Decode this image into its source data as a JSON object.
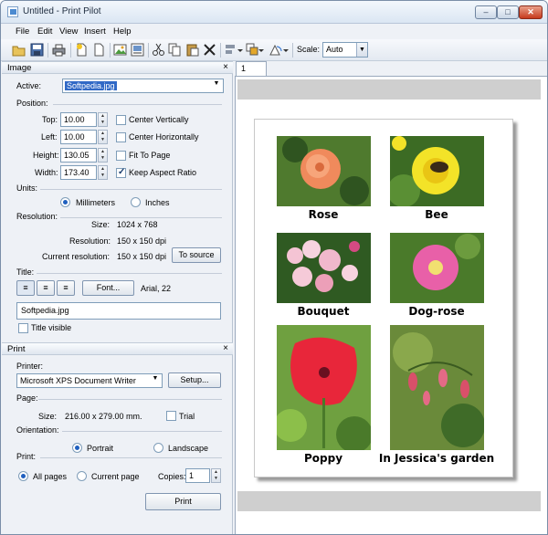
{
  "window": {
    "title": "Untitled - Print Pilot"
  },
  "menu": [
    "File",
    "Edit",
    "View",
    "Insert",
    "Help"
  ],
  "toolbar": {
    "scale_label": "Scale:",
    "scale_value": "Auto"
  },
  "image_panel": {
    "title": "Image",
    "active_label": "Active:",
    "active_value": "Softpedia.jpg",
    "position_label": "Position:",
    "top_label": "Top:",
    "top_value": "10.00",
    "left_label": "Left:",
    "left_value": "10.00",
    "height_label": "Height:",
    "height_value": "130.05",
    "width_label": "Width:",
    "width_value": "173.40",
    "center_vertically": "Center Vertically",
    "center_horizontally": "Center Horizontally",
    "fit_to_page": "Fit To Page",
    "keep_aspect": "Keep Aspect Ratio",
    "units_label": "Units:",
    "millimeters": "Millimeters",
    "inches": "Inches",
    "resolution_label": "Resolution:",
    "size_label": "Size:",
    "size_value": "1024 x 768",
    "resolution_row_label": "Resolution:",
    "resolution_value": "150 x 150 dpi",
    "current_resolution_label": "Current resolution:",
    "current_resolution_value": "150 x 150 dpi",
    "to_source": "To source",
    "title_label": "Title:",
    "font_button": "Font...",
    "font_value": "Arial, 22",
    "title_text": "Softpedia.jpg",
    "title_visible": "Title visible"
  },
  "print_panel": {
    "title": "Print",
    "printer_label": "Printer:",
    "printer_value": "Microsoft XPS Document Writer",
    "setup": "Setup...",
    "page_label": "Page:",
    "page_size_label": "Size:",
    "page_size_value": "216.00 x 279.00 mm.",
    "trial": "Trial",
    "orientation_label": "Orientation:",
    "portrait": "Portrait",
    "landscape": "Landscape",
    "print_label": "Print:",
    "all_pages": "All pages",
    "current_page": "Current page",
    "copies_label": "Copies:",
    "copies_value": "1",
    "print_button": "Print"
  },
  "tabs": [
    "1"
  ],
  "photos": [
    "Rose",
    "Bee",
    "Bouquet",
    "Dog-rose",
    "Poppy",
    "In Jessica's garden"
  ],
  "icons": [
    "new-icon",
    "open-icon",
    "save-icon",
    "print-icon",
    "page-icon",
    "page-copy-icon",
    "image-icon",
    "image-frame-icon",
    "cut-icon",
    "copy-icon",
    "paste-icon",
    "delete-icon",
    "align-icon",
    "arrange-icon",
    "rotate-icon"
  ]
}
